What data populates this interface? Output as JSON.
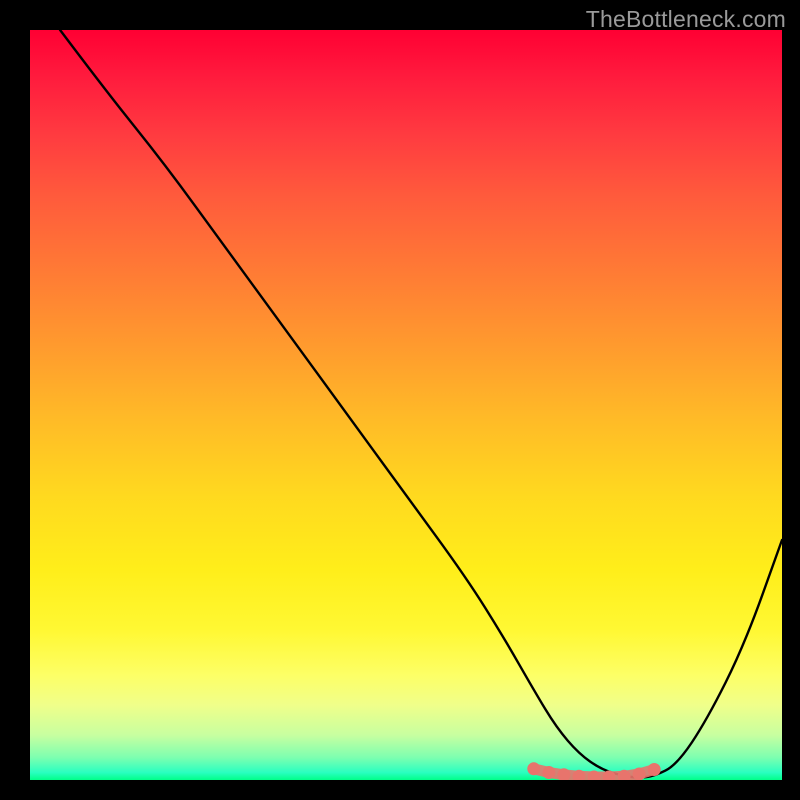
{
  "watermark": "TheBottleneck.com",
  "colors": {
    "background": "#000000",
    "curve_stroke": "#000000",
    "marker_fill": "#e8746c",
    "gradient_top": "#ff0033",
    "gradient_bottom": "#00ff88"
  },
  "chart_data": {
    "type": "line",
    "title": "",
    "xlabel": "",
    "ylabel": "",
    "xlim": [
      0,
      100
    ],
    "ylim": [
      0,
      100
    ],
    "grid": false,
    "legend": false,
    "series": [
      {
        "name": "bottleneck-curve",
        "x": [
          4,
          10,
          18,
          26,
          34,
          42,
          50,
          58,
          63,
          67,
          70,
          73,
          76,
          79,
          81,
          83,
          86,
          90,
          95,
          100
        ],
        "y": [
          100,
          92,
          82,
          71,
          60,
          49,
          38,
          27,
          19,
          12,
          7,
          3.5,
          1.4,
          0.5,
          0.3,
          0.5,
          2,
          8,
          18,
          32
        ]
      }
    ],
    "markers": {
      "name": "highlight-band",
      "x": [
        67,
        69,
        71,
        73,
        75,
        77,
        79,
        81,
        83
      ],
      "y": [
        1.5,
        1.0,
        0.7,
        0.5,
        0.4,
        0.4,
        0.5,
        0.8,
        1.4
      ]
    },
    "annotations": []
  }
}
